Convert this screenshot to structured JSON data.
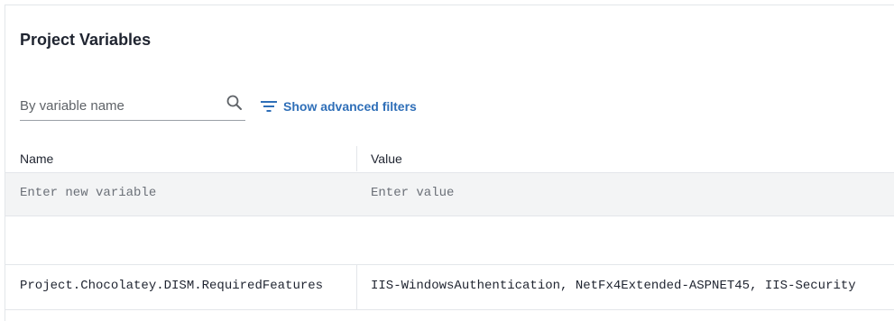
{
  "page": {
    "title": "Project Variables"
  },
  "search": {
    "placeholder": "By variable name",
    "value": ""
  },
  "filters": {
    "label": "Show advanced filters"
  },
  "table": {
    "columns": [
      "Name",
      "Value"
    ],
    "new_row": {
      "name_placeholder": "Enter new variable",
      "value_placeholder": "Enter value"
    },
    "rows": [
      {
        "name": "Project.Chocolatey.DISM.RequiredFeatures",
        "value": "IIS-WindowsAuthentication, NetFx4Extended-ASPNET45, IIS-Security"
      }
    ]
  },
  "colors": {
    "accent": "#2f6fb8",
    "border": "#e3e6ea",
    "new_row_bg": "#f3f4f5",
    "text": "#1f2430"
  },
  "icons": {
    "search": "search-icon",
    "filter": "filter-list-icon"
  }
}
